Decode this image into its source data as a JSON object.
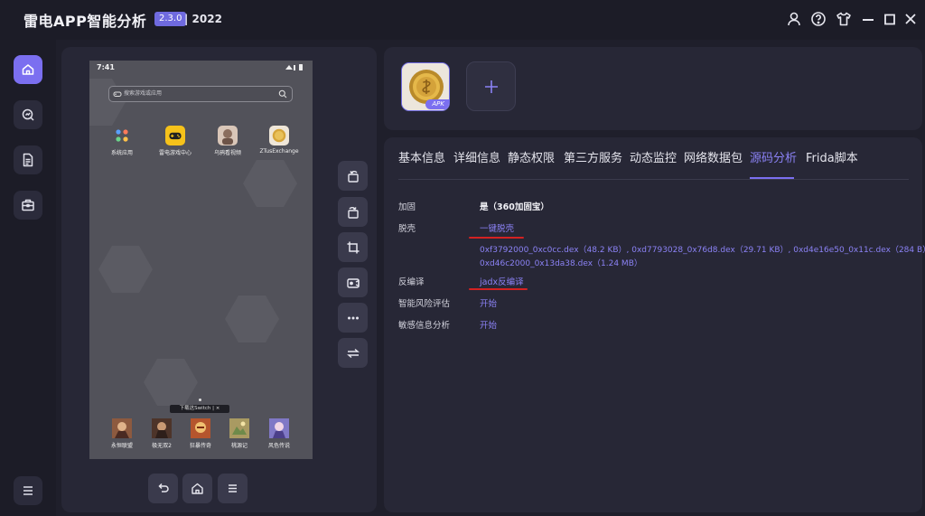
{
  "app": {
    "title": "雷电APP智能分析",
    "version": "2.3.0",
    "year": "| 2022"
  },
  "window_controls": [
    "user-icon",
    "help-icon",
    "shirt-icon",
    "minimize-icon",
    "maximize-icon",
    "close-icon"
  ],
  "sidebar": {
    "items": [
      {
        "icon": "home-icon",
        "active": true
      },
      {
        "icon": "search-analysis-icon",
        "active": false
      },
      {
        "icon": "document-icon",
        "active": false
      },
      {
        "icon": "toolbox-icon",
        "active": false
      }
    ],
    "menu_icon": "menu-icon"
  },
  "phone": {
    "status_time": "7:41",
    "search_placeholder": "搜索游戏或应用",
    "top_apps": [
      {
        "label": "系统应用",
        "icon": "system-apps-icon"
      },
      {
        "label": "雷电游戏中心",
        "icon": "game-center-icon"
      },
      {
        "label": "乌鸦看视频",
        "icon": "video-app-icon"
      },
      {
        "label": "ZTusExchange",
        "icon": "coin-app-icon"
      }
    ],
    "switch_tip": "下载这Switch  | ×",
    "dock_apps": [
      {
        "label": "永恒联盟"
      },
      {
        "label": "极无双2"
      },
      {
        "label": "狂暴传奇"
      },
      {
        "label": "桃源记"
      },
      {
        "label": "风色传说"
      }
    ]
  },
  "device_tools": [
    "rotate-left-icon",
    "rotate-right-icon",
    "crop-icon",
    "record-icon",
    "more-icon",
    "switch-icon"
  ],
  "device_nav": [
    "back-icon",
    "home-icon",
    "menu-icon"
  ],
  "apk": {
    "badge": "APK",
    "add_icon": "plus-icon"
  },
  "tabs": [
    {
      "label": "基本信息",
      "active": false
    },
    {
      "label": "详细信息",
      "active": false
    },
    {
      "label": "静态权限",
      "active": false
    },
    {
      "label": "第三方服务",
      "active": false
    },
    {
      "label": "动态监控",
      "active": false
    },
    {
      "label": "网络数据包",
      "active": false
    },
    {
      "label": "源码分析",
      "active": true
    },
    {
      "label": "Frida脚本",
      "active": false
    }
  ],
  "source_analysis": {
    "rows": [
      {
        "label": "加固",
        "value": "是（360加固宝）"
      },
      {
        "label": "脱壳",
        "value": "一键脱壳"
      },
      {
        "label": "反编译",
        "value": "jadx反编译"
      },
      {
        "label": "智能风险评估",
        "value": "开始"
      },
      {
        "label": "敏感信息分析",
        "value": "开始"
      }
    ],
    "dex_line1": "0xf3792000_0xc0cc.dex（48.2 KB）, 0xd7793028_0x76d8.dex（29.71 KB）, 0xd4e16e50_0x11c.dex（284 B）,",
    "dex_line2": "0xd46c2000_0x13da38.dex（1.24 MB）"
  },
  "colors": {
    "accent": "#7b6ff0",
    "link": "#8b82f5",
    "annotation_red": "#d32222"
  }
}
